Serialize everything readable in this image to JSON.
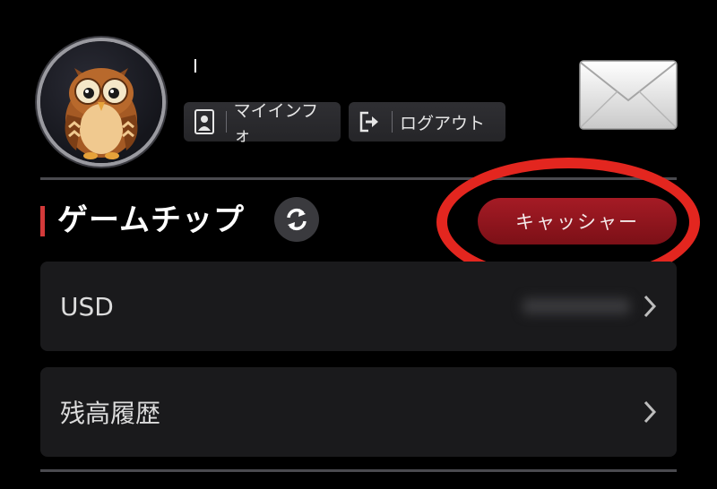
{
  "profile": {
    "avatar_icon": "owl-avatar-icon",
    "username": "I"
  },
  "account_buttons": {
    "myinfo": {
      "label": "マイインフォ",
      "icon": "user-card-icon"
    },
    "logout": {
      "label": "ログアウト",
      "icon": "sign-out-icon"
    }
  },
  "mail": {
    "icon": "envelope-icon"
  },
  "section": {
    "title": "ゲームチップ",
    "refresh_icon": "refresh-icon",
    "accent_color": "#d33a3a"
  },
  "cashier": {
    "label": "キャッシャー",
    "color": "#a51b25",
    "highlight_color": "#e3261f"
  },
  "rows": [
    {
      "label": "USD",
      "chevron": "chevron-right-icon"
    },
    {
      "label": "残高履歴",
      "chevron": "chevron-right-icon"
    }
  ]
}
